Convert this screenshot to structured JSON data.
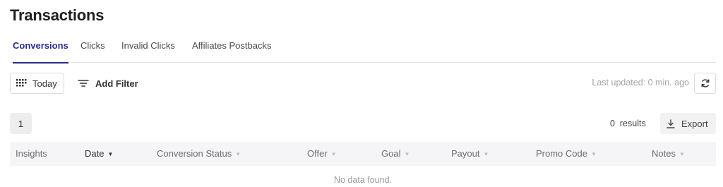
{
  "page": {
    "title": "Transactions"
  },
  "tabs": [
    {
      "label": "Conversions",
      "active": true
    },
    {
      "label": "Clicks",
      "active": false
    },
    {
      "label": "Invalid Clicks",
      "active": false
    },
    {
      "label": "Affiliates Postbacks",
      "active": false
    }
  ],
  "toolbar": {
    "date_label": "Today",
    "date_icon": "calendar-grid-icon",
    "filter_label": "Add Filter",
    "filter_icon": "filter-lines-icon",
    "last_updated": "Last updated: 0 min. ago",
    "refresh_icon": "refresh-icon"
  },
  "pagination": {
    "current_page": "1"
  },
  "results": {
    "text": "0  results"
  },
  "export": {
    "label": "Export",
    "icon": "download-icon"
  },
  "table": {
    "columns": [
      {
        "label": "Insights",
        "sortable": false,
        "sorted": false
      },
      {
        "label": "Date",
        "sortable": true,
        "sorted": true
      },
      {
        "label": "Conversion Status",
        "sortable": true,
        "sorted": false
      },
      {
        "label": "Offer",
        "sortable": true,
        "sorted": false
      },
      {
        "label": "Goal",
        "sortable": true,
        "sorted": false
      },
      {
        "label": "Payout",
        "sortable": true,
        "sorted": false
      },
      {
        "label": "Promo Code",
        "sortable": true,
        "sorted": false
      },
      {
        "label": "Notes",
        "sortable": true,
        "sorted": false
      }
    ],
    "empty_message": "No data found."
  },
  "colors": {
    "accent": "#2a2f8f",
    "header_bg": "#f5f5f7",
    "muted_text": "#a3a3a3"
  }
}
